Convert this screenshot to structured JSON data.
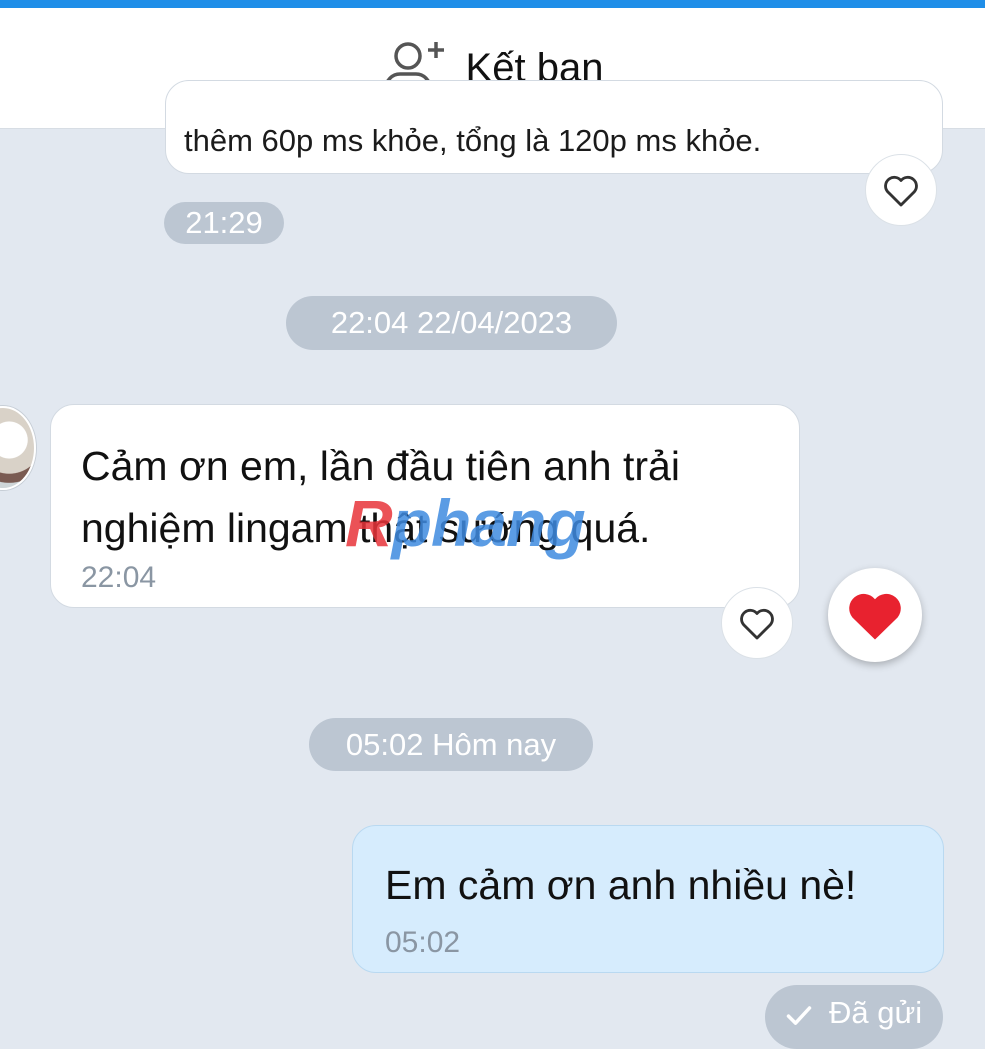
{
  "header": {
    "add_friend_label": "Kết bạn",
    "add_friend_icon": "add-user-icon"
  },
  "messages": {
    "previous": {
      "text": "thêm 60p ms khỏe, tổng là 120p ms khỏe.",
      "time": "21:29"
    },
    "date_separator_1": "22:04 22/04/2023",
    "received": {
      "text": "Cảm ơn em, lần đầu tiên anh trải nghiệm lingam thật sướng quá.",
      "time": "22:04",
      "reaction_icon": "heart-icon",
      "reaction_color": "#e8222f"
    },
    "date_separator_2": "05:02 Hôm nay",
    "sent": {
      "text": "Em cảm ơn anh nhiều nè!",
      "time": "05:02",
      "status": "Đã gửi",
      "status_icon": "check-icon"
    }
  },
  "watermark": {
    "prefix": "R",
    "text": "phang"
  },
  "colors": {
    "accent": "#1f8ee8",
    "background": "#e2e8f0",
    "sent_bubble": "#d6ecfd",
    "pill": "#bcc6d2"
  }
}
